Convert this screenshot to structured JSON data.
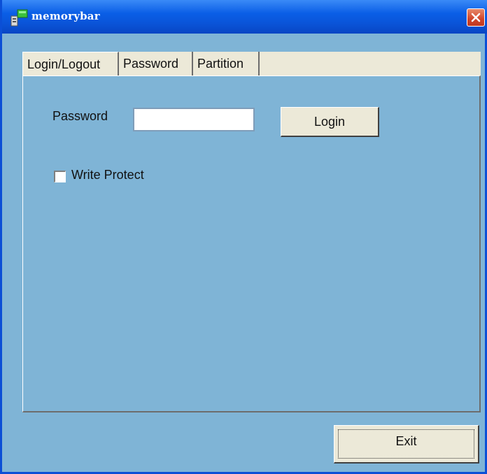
{
  "window": {
    "title": "memorybar"
  },
  "tabs": [
    {
      "label": "Login/Logout",
      "selected": true
    },
    {
      "label": "Password",
      "selected": false
    },
    {
      "label": "Partition",
      "selected": false
    }
  ],
  "login": {
    "password_label": "Password",
    "password_value": "",
    "login_button": "Login",
    "write_protect_label": "Write Protect",
    "write_protect_checked": false
  },
  "footer": {
    "exit_button": "Exit"
  },
  "colors": {
    "titlebar": "#0a54d8",
    "panel_background": "#7fb4d6",
    "tab_strip": "#ece9d8",
    "close_button": "#d0442a"
  }
}
